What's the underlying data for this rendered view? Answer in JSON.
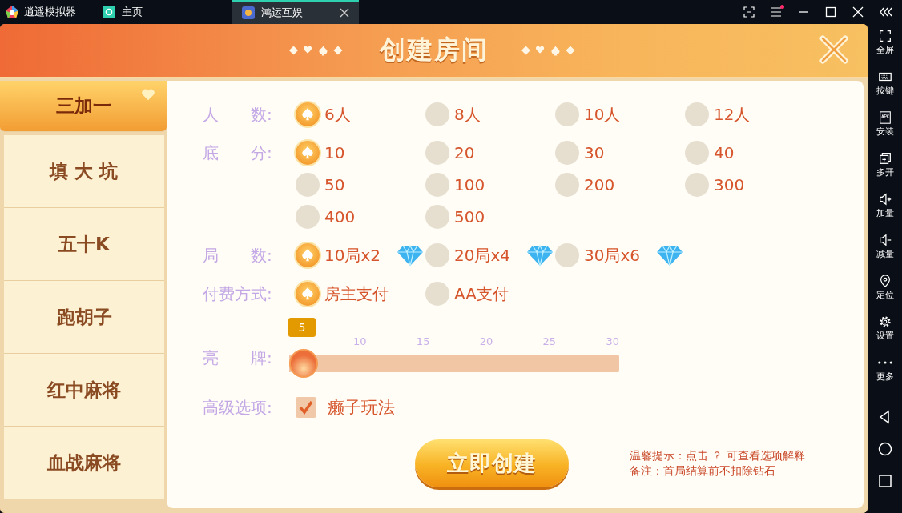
{
  "titlebar": {
    "app_name": "逍遥模拟器",
    "tabs": [
      {
        "label": "主页",
        "selected": false,
        "closable": false
      },
      {
        "label": "鸿运互娱",
        "selected": true,
        "closable": true
      }
    ],
    "notification_dot": true
  },
  "sidebar": {
    "items": [
      {
        "label": "全屏",
        "kind": "fullscreen"
      },
      {
        "label": "按键",
        "kind": "keyboard"
      },
      {
        "label": "安装",
        "kind": "apk"
      },
      {
        "label": "多开",
        "kind": "multi"
      },
      {
        "label": "加量",
        "kind": "volup"
      },
      {
        "label": "减量",
        "kind": "voldown"
      },
      {
        "label": "定位",
        "kind": "location"
      },
      {
        "label": "设置",
        "kind": "settings"
      },
      {
        "label": "更多",
        "kind": "more"
      }
    ]
  },
  "dialog": {
    "title": "创建房间",
    "game_tabs": [
      {
        "label": "三加一",
        "selected": true,
        "badge": true
      },
      {
        "label": "填 大 坑",
        "selected": false,
        "badge": false
      },
      {
        "label": "五十K",
        "selected": false,
        "badge": false
      },
      {
        "label": "跑胡子",
        "selected": false,
        "badge": false
      },
      {
        "label": "红中麻将",
        "selected": false,
        "badge": false
      },
      {
        "label": "血战麻将",
        "selected": false,
        "badge": false
      }
    ],
    "option_groups": [
      {
        "label": "人　　数:",
        "options": [
          {
            "label": "6人",
            "selected": true,
            "diamond": false
          },
          {
            "label": "8人",
            "selected": false,
            "diamond": false
          },
          {
            "label": "10人",
            "selected": false,
            "diamond": false
          },
          {
            "label": "12人",
            "selected": false,
            "diamond": false
          }
        ]
      },
      {
        "label": "底　　分:",
        "options": [
          {
            "label": "10",
            "selected": true,
            "diamond": false
          },
          {
            "label": "20",
            "selected": false,
            "diamond": false
          },
          {
            "label": "30",
            "selected": false,
            "diamond": false
          },
          {
            "label": "40",
            "selected": false,
            "diamond": false
          },
          {
            "label": "50",
            "selected": false,
            "diamond": false
          },
          {
            "label": "100",
            "selected": false,
            "diamond": false
          },
          {
            "label": "200",
            "selected": false,
            "diamond": false
          },
          {
            "label": "300",
            "selected": false,
            "diamond": false
          },
          {
            "label": "400",
            "selected": false,
            "diamond": false
          },
          {
            "label": "500",
            "selected": false,
            "diamond": false
          }
        ]
      },
      {
        "label": "局　　数:",
        "options": [
          {
            "label": "10局x2",
            "selected": true,
            "diamond": true
          },
          {
            "label": "20局x4",
            "selected": false,
            "diamond": true
          },
          {
            "label": "30局x6",
            "selected": false,
            "diamond": true
          }
        ]
      },
      {
        "label": "付费方式:",
        "options": [
          {
            "label": "房主支付",
            "selected": true,
            "diamond": false
          },
          {
            "label": "AA支付",
            "selected": false,
            "diamond": false
          }
        ]
      }
    ],
    "slider": {
      "label": "亮　　牌:",
      "value": "5",
      "level": 0,
      "ticks": [
        "10",
        "15",
        "20",
        "25",
        "30"
      ]
    },
    "advanced": {
      "label": "高级选项:",
      "options": [
        {
          "label": "癞子玩法",
          "checked": true
        }
      ]
    },
    "create_button": "立即创建",
    "tips": [
      "温馨提示：点击 ？ 可查看选项解释",
      "备注：首局结算前不扣除钻石"
    ]
  }
}
